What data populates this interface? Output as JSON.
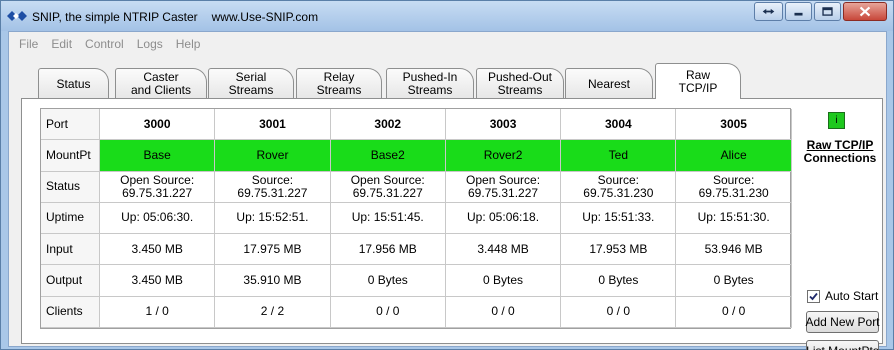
{
  "window": {
    "title": "SNIP, the simple NTRIP Caster",
    "url": "www.Use-SNIP.com"
  },
  "menu": [
    "File",
    "Edit",
    "Control",
    "Logs",
    "Help"
  ],
  "tabs": [
    {
      "lines": [
        "Status"
      ],
      "active": false
    },
    {
      "lines": [
        "Caster",
        "and Clients"
      ],
      "active": false
    },
    {
      "lines": [
        "Serial",
        "Streams"
      ],
      "active": false
    },
    {
      "lines": [
        "Relay",
        "Streams"
      ],
      "active": false
    },
    {
      "lines": [
        "Pushed-In",
        "Streams"
      ],
      "active": false
    },
    {
      "lines": [
        "Pushed-Out",
        "Streams"
      ],
      "active": false
    },
    {
      "lines": [
        "Nearest"
      ],
      "active": false
    },
    {
      "lines": [
        "Raw",
        "TCP/IP"
      ],
      "active": true
    }
  ],
  "table": {
    "row_labels": [
      "Port",
      "MountPt",
      "Status",
      "Uptime",
      "Input",
      "Output",
      "Clients"
    ],
    "ports": [
      {
        "port": "3000",
        "mount": "Base",
        "status": [
          "Open Source:",
          "69.75.31.227"
        ],
        "uptime": "Up: 05:06:30.",
        "input": "3.450 MB",
        "output": "3.450 MB",
        "clients": "1 / 0"
      },
      {
        "port": "3001",
        "mount": "Rover",
        "status": [
          "Source:",
          "69.75.31.227"
        ],
        "uptime": "Up: 15:52:51.",
        "input": "17.975 MB",
        "output": "35.910 MB",
        "clients": "2 / 2"
      },
      {
        "port": "3002",
        "mount": "Base2",
        "status": [
          "Open Source:",
          "69.75.31.227"
        ],
        "uptime": "Up: 15:51:45.",
        "input": "17.956 MB",
        "output": "0 Bytes",
        "clients": "0 / 0"
      },
      {
        "port": "3003",
        "mount": "Rover2",
        "status": [
          "Open Source:",
          "69.75.31.227"
        ],
        "uptime": "Up: 05:06:18.",
        "input": "3.448 MB",
        "output": "0 Bytes",
        "clients": "0 / 0"
      },
      {
        "port": "3004",
        "mount": "Ted",
        "status": [
          "Source:",
          "69.75.31.230"
        ],
        "uptime": "Up: 15:51:33.",
        "input": "17.953 MB",
        "output": "0 Bytes",
        "clients": "0 / 0"
      },
      {
        "port": "3005",
        "mount": "Alice",
        "status": [
          "Source:",
          "69.75.31.230"
        ],
        "uptime": "Up: 15:51:30.",
        "input": "53.946 MB",
        "output": "0 Bytes",
        "clients": "0 / 0"
      }
    ],
    "mount_color": "#19dc19"
  },
  "side": {
    "indicator": "i",
    "indicator_color": "#1ec81e",
    "title_line1": "Raw TCP/IP",
    "title_line2": "Connections",
    "auto_start_label": "Auto Start",
    "auto_start_checked": true,
    "add_port_label": "Add New Port",
    "list_mounts_label": "List MountPts"
  },
  "icons": {
    "app": "snip-logo-icon",
    "restore": "restore-arrows-icon",
    "minimize": "minimize-icon",
    "maximize": "maximize-icon",
    "close": "close-icon"
  }
}
